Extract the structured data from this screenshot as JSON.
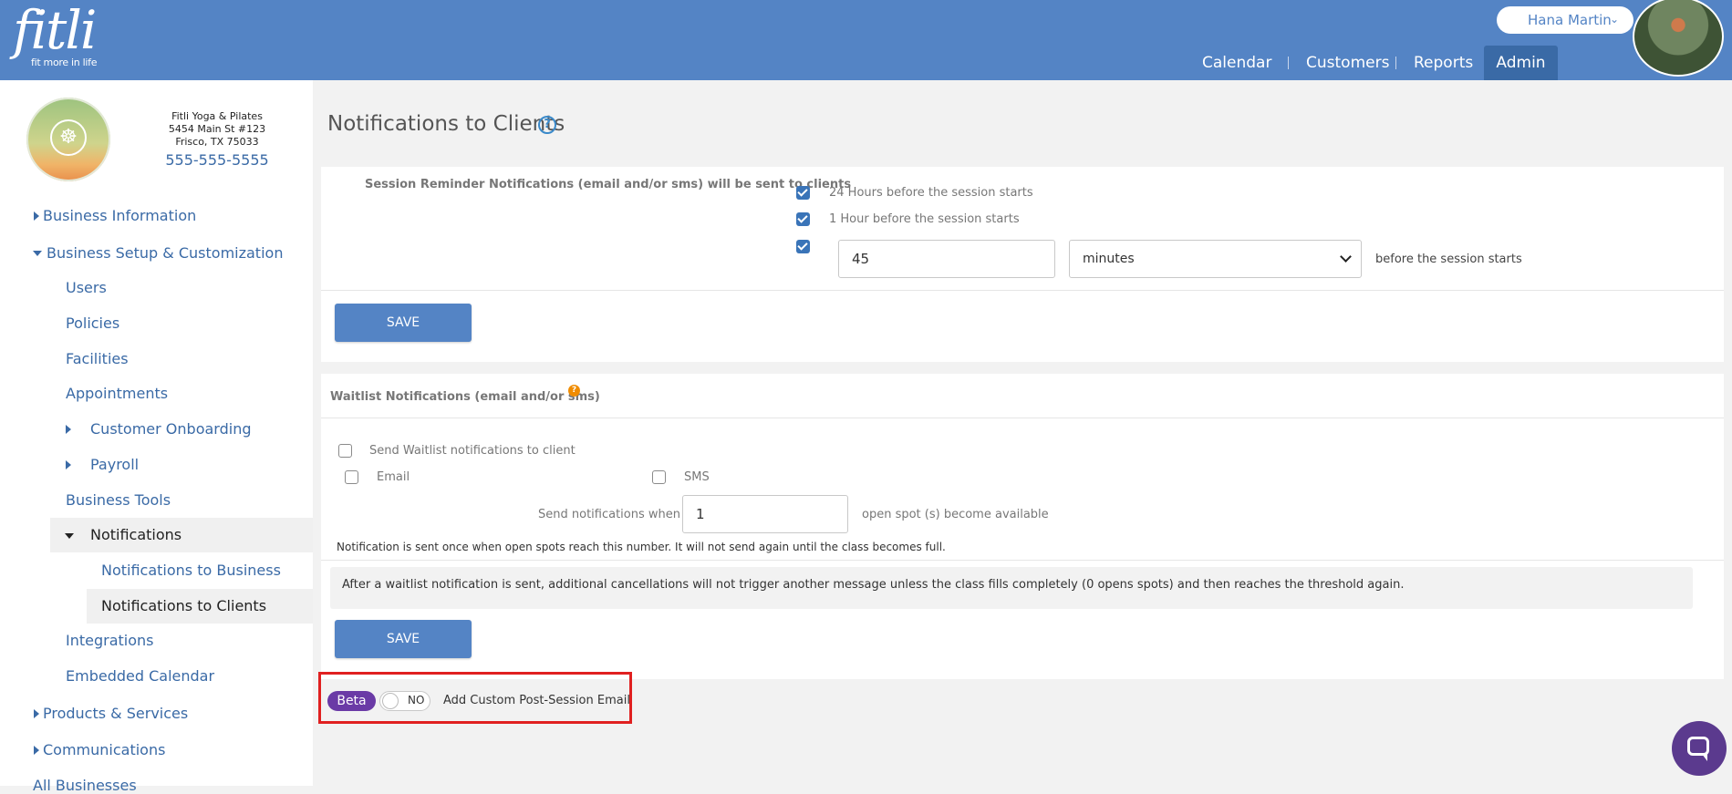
{
  "header": {
    "logo_text": "fitli",
    "logo_tagline": "fit more in life",
    "user_name": "Hana Martin",
    "nav": [
      "Calendar",
      "Customers",
      "Reports",
      "Admin"
    ],
    "active_nav": "Admin",
    "brand_color": "#5484c5"
  },
  "business": {
    "name": "Fitli Yoga & Pilates",
    "address1": "5454 Main St #123",
    "address2": "Frisco, TX 75033",
    "phone": "555-555-5555"
  },
  "sidebar": {
    "items": [
      {
        "label": "Business Information"
      },
      {
        "label": "Business Setup & Customization"
      },
      {
        "label": "Users"
      },
      {
        "label": "Policies"
      },
      {
        "label": "Facilities"
      },
      {
        "label": "Appointments"
      },
      {
        "label": "Customer Onboarding"
      },
      {
        "label": "Payroll"
      },
      {
        "label": "Business Tools"
      },
      {
        "label": "Notifications"
      },
      {
        "label": "Notifications to Business"
      },
      {
        "label": "Notifications to Clients"
      },
      {
        "label": "Integrations"
      },
      {
        "label": "Embedded Calendar"
      },
      {
        "label": "Products & Services"
      },
      {
        "label": "Communications"
      },
      {
        "label": "All Businesses"
      }
    ],
    "active_item": "Notifications to Clients"
  },
  "main": {
    "title": "Notifications to Clients",
    "help_glyph": "?",
    "reminders": {
      "heading": "Session Reminder Notifications (email and/or sms) will be sent to clients",
      "opt_24h": "24 Hours before the session starts",
      "opt_24h_checked": true,
      "opt_1h": "1 Hour before the session starts",
      "opt_1h_checked": true,
      "custom_checked": true,
      "custom_value": "45",
      "custom_unit": "minutes",
      "custom_suffix": "before the session starts",
      "save": "SAVE"
    },
    "waitlist": {
      "heading": "Waitlist Notifications (email and/or sms)",
      "help_glyph": "?",
      "send_label": "Send Waitlist notifications to client",
      "send_checked": false,
      "email_label": "Email",
      "email_checked": false,
      "sms_label": "SMS",
      "sms_checked": false,
      "when_label": "Send notifications when",
      "when_value": "1",
      "when_suffix": "open spot (s) become available",
      "note": "Notification is sent once when open spots reach this number. It will not send again until the class becomes full.",
      "info": "After a waitlist notification is sent, additional cancellations will not trigger another message unless the class fills completely (0 opens spots) and then reaches the threshold again.",
      "save": "SAVE"
    },
    "beta": {
      "badge": "Beta",
      "toggle_text": "NO",
      "toggle_on": false,
      "label": "Add Custom Post-Session Email"
    }
  }
}
